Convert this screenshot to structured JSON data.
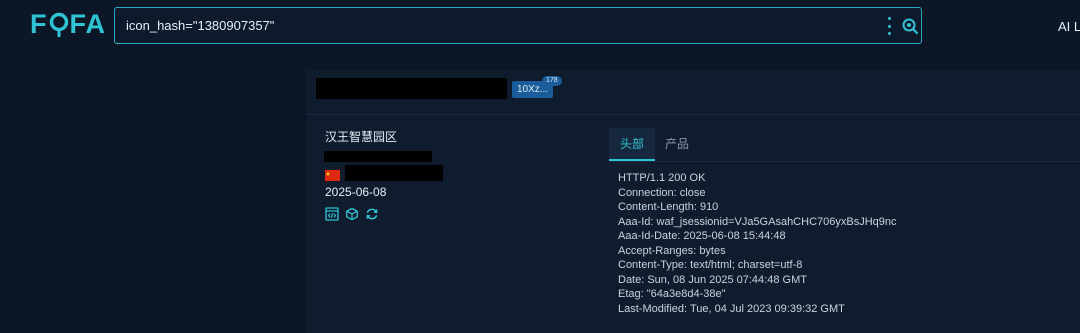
{
  "header": {
    "logo_text": "FOFA",
    "logo_part_1": "F",
    "logo_part_2": "FA",
    "search_value": "icon_hash=\"1380907357\"",
    "ai_link": "AI L"
  },
  "result": {
    "tag_chip": "10Xz...",
    "tag_count": "178",
    "org_name": "汉王智慧园区",
    "date": "2025-06-08",
    "tabs": [
      {
        "label": "头部",
        "active": true
      },
      {
        "label": "产品",
        "active": false
      }
    ],
    "response_headers": [
      "HTTP/1.1 200 OK",
      "Connection: close",
      "Content-Length: 910",
      "Aaa-Id: waf_jsessionid=VJa5GAsahCHC706yxBsJHq9nc",
      "Aaa-Id-Date: 2025-06-08 15:44:48",
      "Accept-Ranges: bytes",
      "Content-Type: text/html; charset=utf-8",
      "Date: Sun, 08 Jun 2025 07:44:48 GMT",
      "Etag: \"64a3e8d4-38e\"",
      "Last-Modified: Tue, 04 Jul 2023 09:39:32 GMT"
    ]
  },
  "icons": {
    "logo_o": "magnifier-pin-icon",
    "menu": "kebab-menu-icon",
    "search": "search-icon",
    "flag": "china-flag-icon",
    "code": "code-icon",
    "cube": "cube-icon",
    "refresh": "refresh-icon"
  },
  "colors": {
    "accent": "#2ec4d6",
    "background": "#0b1626",
    "card": "#0f1c2e",
    "chip": "#1a5d9a"
  }
}
